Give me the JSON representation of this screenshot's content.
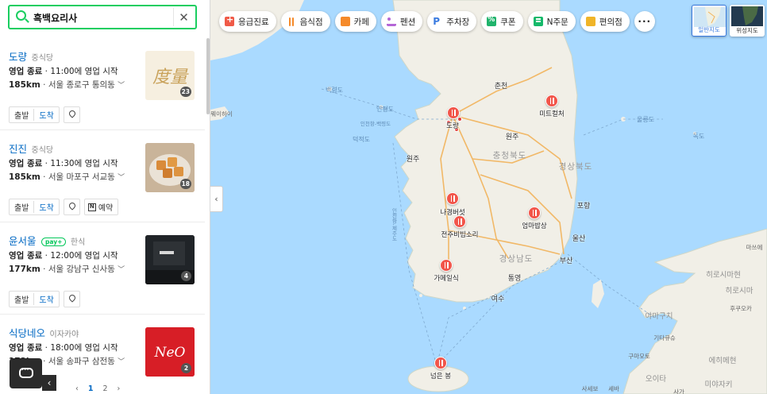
{
  "search": {
    "value": "흑백요리사",
    "clear_label": "✕"
  },
  "results": [
    {
      "name": "도량",
      "category": "중식당",
      "npay": "",
      "status": "영업 종료",
      "hours": "11:00에 영업 시작",
      "distance": "185km",
      "address": "서울 종로구 통의동",
      "photo_count": "23",
      "depart": "출발",
      "arrive": "도착",
      "reserve": ""
    },
    {
      "name": "진진",
      "category": "중식당",
      "npay": "",
      "status": "영업 종료",
      "hours": "11:30에 영업 시작",
      "distance": "185km",
      "address": "서울 마포구 서교동",
      "photo_count": "18",
      "depart": "출발",
      "arrive": "도착",
      "reserve": "예약"
    },
    {
      "name": "윤서울",
      "category": "한식",
      "npay": "pay+",
      "status": "영업 종료",
      "hours": "12:00에 영업 시작",
      "distance": "177km",
      "address": "서울 강남구 신사동",
      "photo_count": "4",
      "depart": "출발",
      "arrive": "도착",
      "reserve": ""
    },
    {
      "name": "식당네오",
      "category": "이자카야",
      "npay": "",
      "status": "영업 종료",
      "hours": "18:00에 영업 시작",
      "distance": "173km",
      "address": "서울 송파구 삼전동",
      "photo_count": "2",
      "depart": "출발",
      "arrive": "도착",
      "reserve": ""
    }
  ],
  "thumb_text": {
    "doryang": "度量",
    "neo": "NeO"
  },
  "pagination": {
    "prev": "‹",
    "pages": [
      "1",
      "2"
    ],
    "next": "›"
  },
  "chips": [
    {
      "label": "응급진료",
      "icon": "emergency-icon"
    },
    {
      "label": "음식점",
      "icon": "restaurant-icon"
    },
    {
      "label": "카페",
      "icon": "cafe-icon"
    },
    {
      "label": "펜션",
      "icon": "pension-icon"
    },
    {
      "label": "주차장",
      "icon": "parking-icon"
    },
    {
      "label": "쿠폰",
      "icon": "coupon-icon"
    },
    {
      "label": "N주문",
      "icon": "n-order-icon"
    },
    {
      "label": "편의점",
      "icon": "convenience-store-icon"
    }
  ],
  "more_label": "···",
  "map_type": {
    "normal": "일반지도",
    "satellite": "위성지도"
  },
  "map_labels": {
    "seas": [
      "백령도",
      "연평도",
      "인천항-백령도",
      "덕적도",
      "서산",
      "인천항-제주도",
      "목포-제주",
      "울릉도",
      "독도",
      "부산-후쿠오카"
    ],
    "cities": [
      "춘천",
      "원주",
      "서산",
      "포항",
      "울산",
      "부산",
      "통영",
      "여수",
      "제주",
      "미트컬처",
      "나경버섯",
      "전주비빔소리",
      "엄마밥상",
      "가메일식",
      "넘은 봉",
      "도량",
      "마쓰에",
      "돗토리",
      "세바"
    ],
    "provinces": [
      "충청북도",
      "경상북도",
      "경상남도"
    ],
    "japan": [
      "히로시마현",
      "후쿠오카",
      "야마구치",
      "히로시마",
      "기타큐슈",
      "에히메현",
      "구마모토",
      "오이타",
      "미야자키",
      "사세보",
      "사가"
    ],
    "left_edge": "웨이하이"
  },
  "map_pins": [
    {
      "label": "도량"
    },
    {
      "label": "미트컬처"
    },
    {
      "label": "나경버섯"
    },
    {
      "label": "전주비빔소리"
    },
    {
      "label": "엄마밥상"
    },
    {
      "label": "가메일식"
    },
    {
      "label": "넘은 봉"
    }
  ],
  "colors": {
    "accent_green": "#19ce60",
    "link_blue": "#0068c3",
    "pin_red": "#f2554a",
    "sea": "#aadaff",
    "land": "#f2f0e8"
  }
}
